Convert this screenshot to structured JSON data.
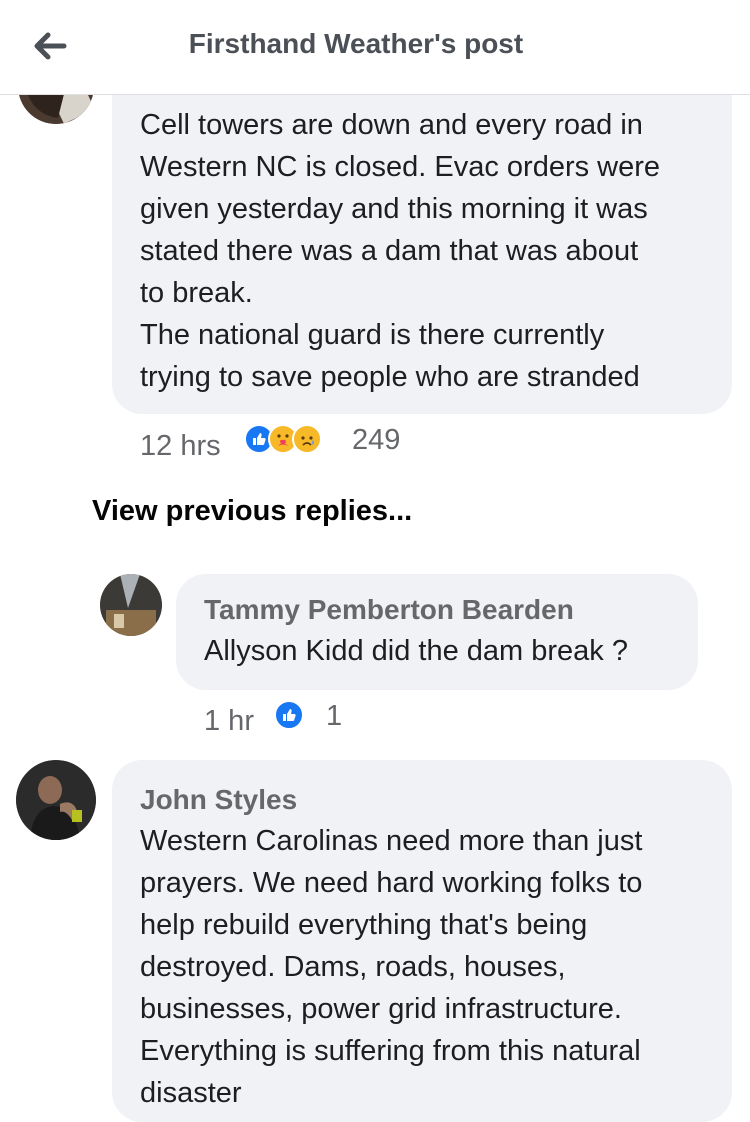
{
  "header": {
    "title": "Firsthand Weather's post",
    "back_icon": "arrow-left-icon"
  },
  "comments": [
    {
      "text": "Cell towers are down and every road in\nWestern NC is closed. Evac orders were\ngiven yesterday and this morning it was\nstated there was a dam that was about\nto break.\nThe national guard is there currently\ntrying to save people who are stranded",
      "time": "12 hrs",
      "reactions": [
        "like-icon",
        "care-icon",
        "sad-icon"
      ],
      "reaction_count": "249"
    },
    {
      "author": "Tammy Pemberton Bearden",
      "text": "Allyson Kidd did the dam break ?",
      "time": "1 hr",
      "reactions": [
        "like-icon"
      ],
      "reaction_count": "1"
    },
    {
      "author": "John Styles",
      "text": "Western Carolinas need more than just\nprayers. We need hard working folks to\nhelp rebuild everything that's being\ndestroyed. Dams, roads, houses,\nbusinesses, power grid infrastructure.\nEverything is suffering from this natural\ndisaster"
    }
  ],
  "view_previous": "View previous replies...",
  "colors": {
    "like": "#1877f2",
    "bubble": "#f0f2f5",
    "meta": "#65676b"
  }
}
